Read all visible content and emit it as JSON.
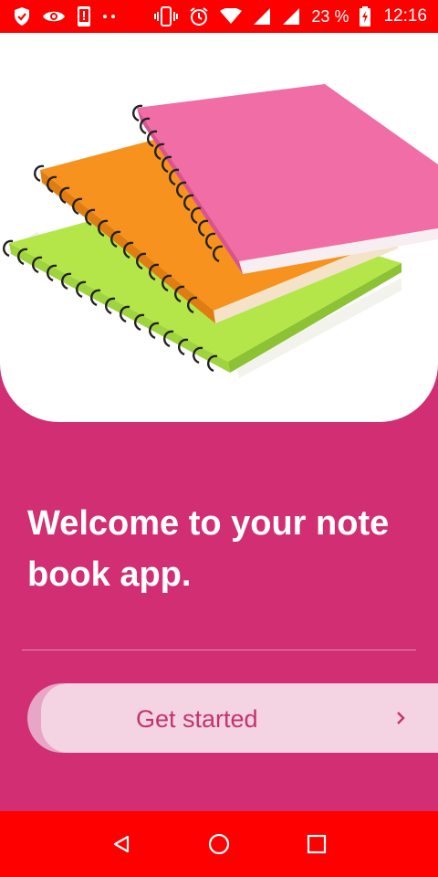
{
  "status_bar": {
    "battery_percent": "23 %",
    "time": "12:16",
    "icons": [
      "shield-icon",
      "eye-icon",
      "phone-alert-icon",
      "dots-icon",
      "vibrate-icon",
      "alarm-icon",
      "wifi-icon",
      "signal-icon",
      "signal-icon",
      "battery-charging-icon"
    ]
  },
  "hero": {
    "image": "spiral-notebooks-illustration",
    "notebook_colors": [
      "#b4e64a",
      "#f7921e",
      "#f06da6"
    ]
  },
  "welcome": {
    "line1": "Welcome to your note",
    "line2": "book app."
  },
  "cta": {
    "label": "Get started",
    "icon": "chevron-right-icon"
  },
  "nav_bar": {
    "buttons": [
      "back-icon",
      "home-icon",
      "recents-icon"
    ]
  },
  "theme": {
    "background": "#d12e73",
    "status_bar": "#ff0000",
    "button_bg": "#f4d3e3",
    "button_text": "#c4336f"
  }
}
